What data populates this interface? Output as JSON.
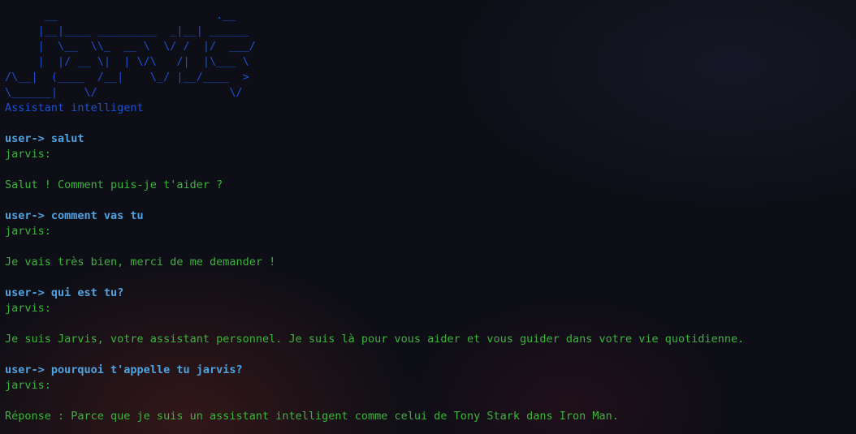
{
  "banner_art": "      __                        .__\n     |__|____ _________  _|__| ______\n     |  \\__  \\\\_  __ \\  \\/ /  |/  ___/\n     |  |/ __ \\|  | \\/\\   /|  |\\___ \\\n/\\__|  (____  /__|    \\_/ |__/____  >\n\\______|    \\/                    \\/",
  "subtitle": "Assistant intelligent",
  "colors": {
    "banner": "#1f4fd1",
    "user": "#4fa3e0",
    "jarvis": "#3cb43c",
    "background": "#0d0e16"
  },
  "conversation": [
    {
      "user_prompt": "user-> salut",
      "jarvis_label": "jarvis:",
      "response": "Salut ! Comment puis-je t'aider ?"
    },
    {
      "user_prompt": "user-> comment vas tu",
      "jarvis_label": "jarvis:",
      "response": "Je vais très bien, merci de me demander !"
    },
    {
      "user_prompt": "user-> qui est tu?",
      "jarvis_label": "jarvis:",
      "response": "Je suis Jarvis, votre assistant personnel. Je suis là pour vous aider et vous guider dans votre vie quotidienne."
    },
    {
      "user_prompt": "user-> pourquoi t'appelle tu jarvis?",
      "jarvis_label": "jarvis:",
      "response": "Réponse : Parce que je suis un assistant intelligent comme celui de Tony Stark dans Iron Man."
    }
  ]
}
